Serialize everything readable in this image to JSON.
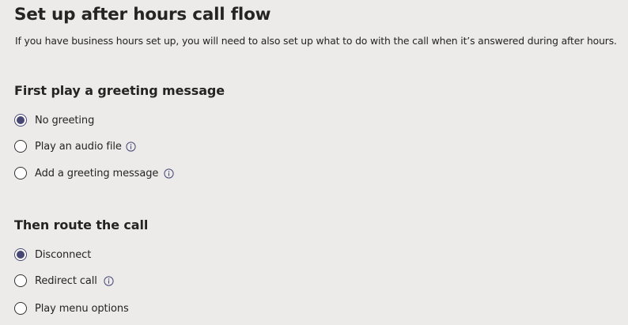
{
  "page": {
    "title": "Set up after hours call flow",
    "description": "If you have business hours set up, you will need to also set up what to do with the call when it’s answered during after hours."
  },
  "greeting": {
    "heading": "First play a greeting message",
    "options": [
      {
        "label": "No greeting",
        "selected": true,
        "info": false
      },
      {
        "label": "Play an audio file",
        "selected": false,
        "info": true
      },
      {
        "label": "Add a greeting message",
        "selected": false,
        "info": true
      }
    ]
  },
  "routing": {
    "heading": "Then route the call",
    "options": [
      {
        "label": "Disconnect",
        "selected": true,
        "info": false
      },
      {
        "label": "Redirect call",
        "selected": false,
        "info": true
      },
      {
        "label": "Play menu options",
        "selected": false,
        "info": false
      }
    ]
  },
  "colors": {
    "background": "#edebe9",
    "accent": "#464775",
    "text": "#252423"
  },
  "icons": {
    "info": "info-circle-icon"
  }
}
